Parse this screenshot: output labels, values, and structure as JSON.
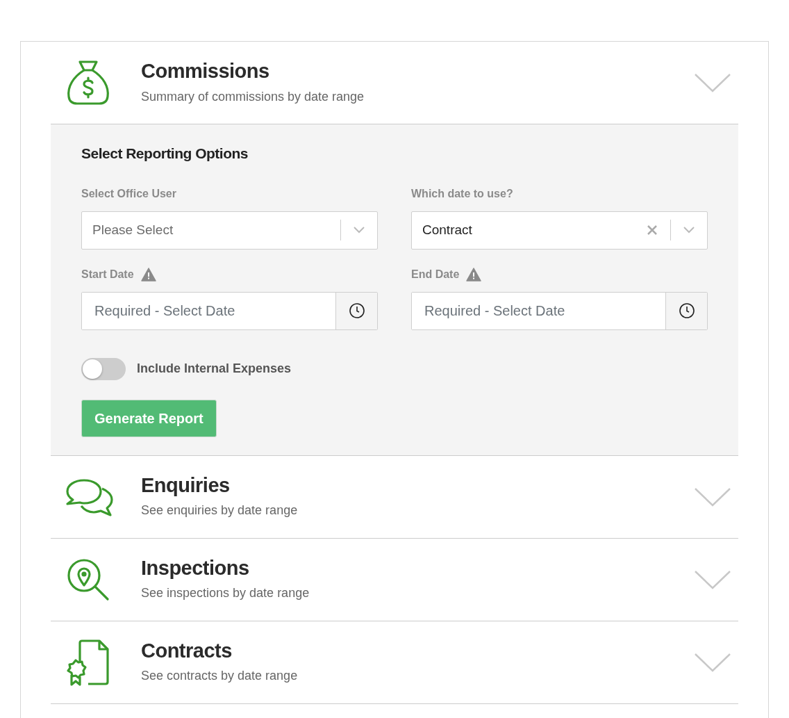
{
  "sections": [
    {
      "title": "Commissions",
      "subtitle": "Summary of commissions by date range",
      "expanded": true
    },
    {
      "title": "Enquiries",
      "subtitle": "See enquiries by date range",
      "expanded": false
    },
    {
      "title": "Inspections",
      "subtitle": "See inspections by date range",
      "expanded": false
    },
    {
      "title": "Contracts",
      "subtitle": "See contracts by date range",
      "expanded": false
    }
  ],
  "options": {
    "heading": "Select Reporting Options",
    "fields": [
      {
        "kind": "select",
        "label": "Select Office User",
        "placeholder": "Please Select"
      },
      {
        "kind": "select",
        "label": "Which date to use?",
        "value": "Contract",
        "clearable": true
      },
      {
        "kind": "date",
        "label": "Start Date",
        "placeholder": "Required - Select Date",
        "warning": true
      },
      {
        "kind": "date",
        "label": "End Date",
        "placeholder": "Required - Select Date",
        "warning": true
      }
    ],
    "toggle": {
      "label": "Include Internal Expenses",
      "on": false
    },
    "button": "Generate Report"
  }
}
